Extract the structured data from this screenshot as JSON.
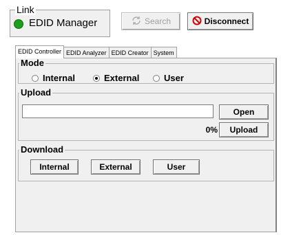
{
  "link": {
    "legend": "Link",
    "status_name": "EDID Manager",
    "status_color": "#1e9e1e",
    "status_icon": "green-led-icon"
  },
  "toolbar": {
    "search_label": "Search",
    "search_icon": "refresh-search-icon",
    "disconnect_label": "Disconnect",
    "disconnect_icon": "no-entry-icon"
  },
  "tabs": [
    {
      "label": "EDID Controller",
      "active": true
    },
    {
      "label": "EDID Analyzer",
      "active": false
    },
    {
      "label": "EDID Creator",
      "active": false
    },
    {
      "label": "System",
      "active": false
    }
  ],
  "mode": {
    "legend": "Mode",
    "options": [
      {
        "label": "Internal",
        "selected": false
      },
      {
        "label": "External",
        "selected": true
      },
      {
        "label": "User",
        "selected": false
      }
    ]
  },
  "upload": {
    "legend": "Upload",
    "file_value": "",
    "open_label": "Open",
    "progress_text": "0%",
    "upload_label": "Upload"
  },
  "download": {
    "legend": "Download",
    "internal_label": "Internal",
    "external_label": "External",
    "user_label": "User"
  }
}
